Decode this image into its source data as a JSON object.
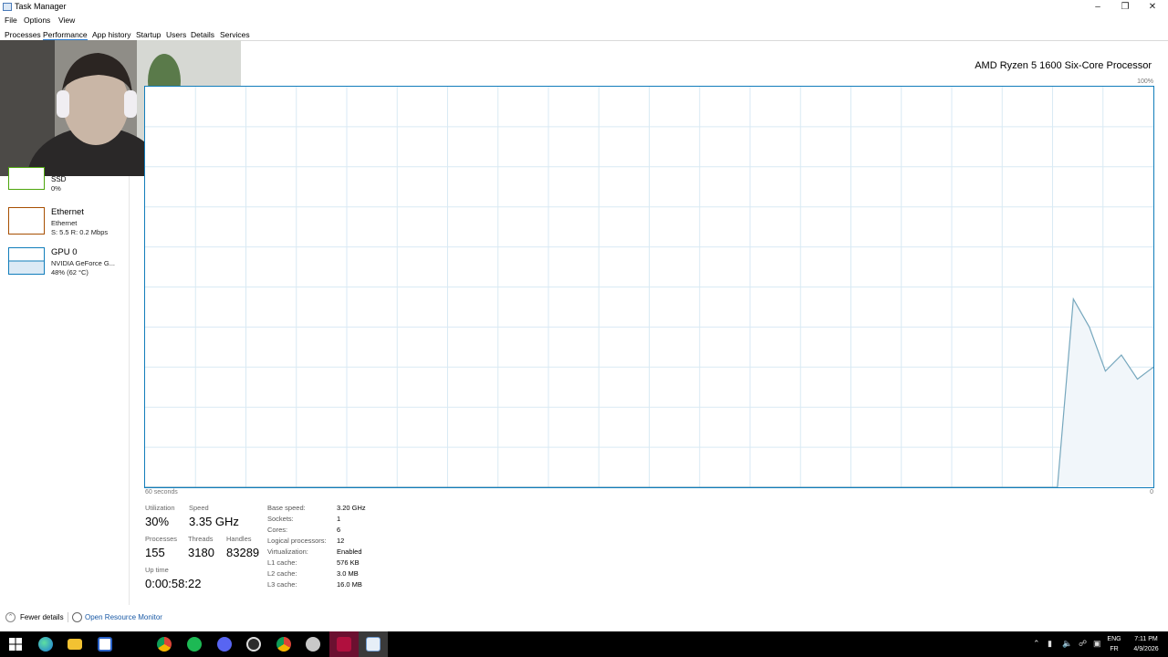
{
  "window": {
    "title": "Task Manager"
  },
  "menu": [
    "File",
    "Options",
    "View"
  ],
  "tabs": [
    "Processes",
    "Performance",
    "App history",
    "Startup",
    "Users",
    "Details",
    "Services"
  ],
  "active_tab": "Performance",
  "sidebar": {
    "ssd": {
      "name": "SSD",
      "usage": "0%",
      "color": "#4da60c"
    },
    "ethernet": {
      "name": "Ethernet",
      "adapter": "Ethernet",
      "throughput": "S: 5.5  R: 0.2 Mbps",
      "color": "#a74f01"
    },
    "gpu": {
      "name": "GPU 0",
      "model": "NVIDIA GeForce G...",
      "usage": "48% (62 °C)",
      "color": "#117dbb"
    }
  },
  "cpu": {
    "processor_name": "AMD Ryzen 5 1600 Six-Core Processor",
    "graph_max": "100%",
    "graph_min": "0",
    "time_span": "60 seconds",
    "utilization_history_pct": [
      0,
      0,
      0,
      0,
      0,
      0,
      0,
      0,
      0,
      0,
      0,
      0,
      0,
      0,
      0,
      0,
      0,
      0,
      0,
      0,
      0,
      0,
      0,
      0,
      0,
      0,
      0,
      0,
      0,
      0,
      0,
      0,
      0,
      0,
      0,
      0,
      0,
      0,
      0,
      0,
      0,
      0,
      0,
      0,
      0,
      0,
      0,
      0,
      0,
      0,
      0,
      0,
      0,
      0,
      0,
      0,
      0,
      0,
      47,
      40,
      29,
      33,
      27,
      30
    ],
    "line_color": "#76a7bd",
    "fill_color": "#f1f6fa",
    "grid_color": "#d9eaf4"
  },
  "stats": {
    "utilization": {
      "label": "Utilization",
      "value": "30%"
    },
    "speed": {
      "label": "Speed",
      "value": "3.35 GHz"
    },
    "processes": {
      "label": "Processes",
      "value": "155"
    },
    "threads": {
      "label": "Threads",
      "value": "3180"
    },
    "handles": {
      "label": "Handles",
      "value": "83289"
    },
    "uptime": {
      "label": "Up time",
      "value": "0:00:58:22"
    }
  },
  "specs": [
    {
      "label": "Base speed:",
      "value": "3.20 GHz"
    },
    {
      "label": "Sockets:",
      "value": "1"
    },
    {
      "label": "Cores:",
      "value": "6"
    },
    {
      "label": "Logical processors:",
      "value": "12"
    },
    {
      "label": "Virtualization:",
      "value": "Enabled"
    },
    {
      "label": "L1 cache:",
      "value": "576 KB"
    },
    {
      "label": "L2 cache:",
      "value": "3.0 MB"
    },
    {
      "label": "L3 cache:",
      "value": "16.0 MB"
    }
  ],
  "footer": {
    "fewer_details": "Fewer details",
    "open_resource_monitor": "Open Resource Monitor"
  },
  "taskbar": {
    "icons": [
      "start-icon",
      "edge-icon",
      "file-explorer-icon",
      "store-icon",
      "chrome-icon",
      "spotify-icon",
      "discord-icon",
      "obs-icon",
      "chrome-profile-icon",
      "app-icon",
      "affinity-icon",
      "task-manager-icon"
    ],
    "language": "ENG",
    "region": "FR",
    "time": "7:11 PM",
    "date": "4/9/2026"
  }
}
